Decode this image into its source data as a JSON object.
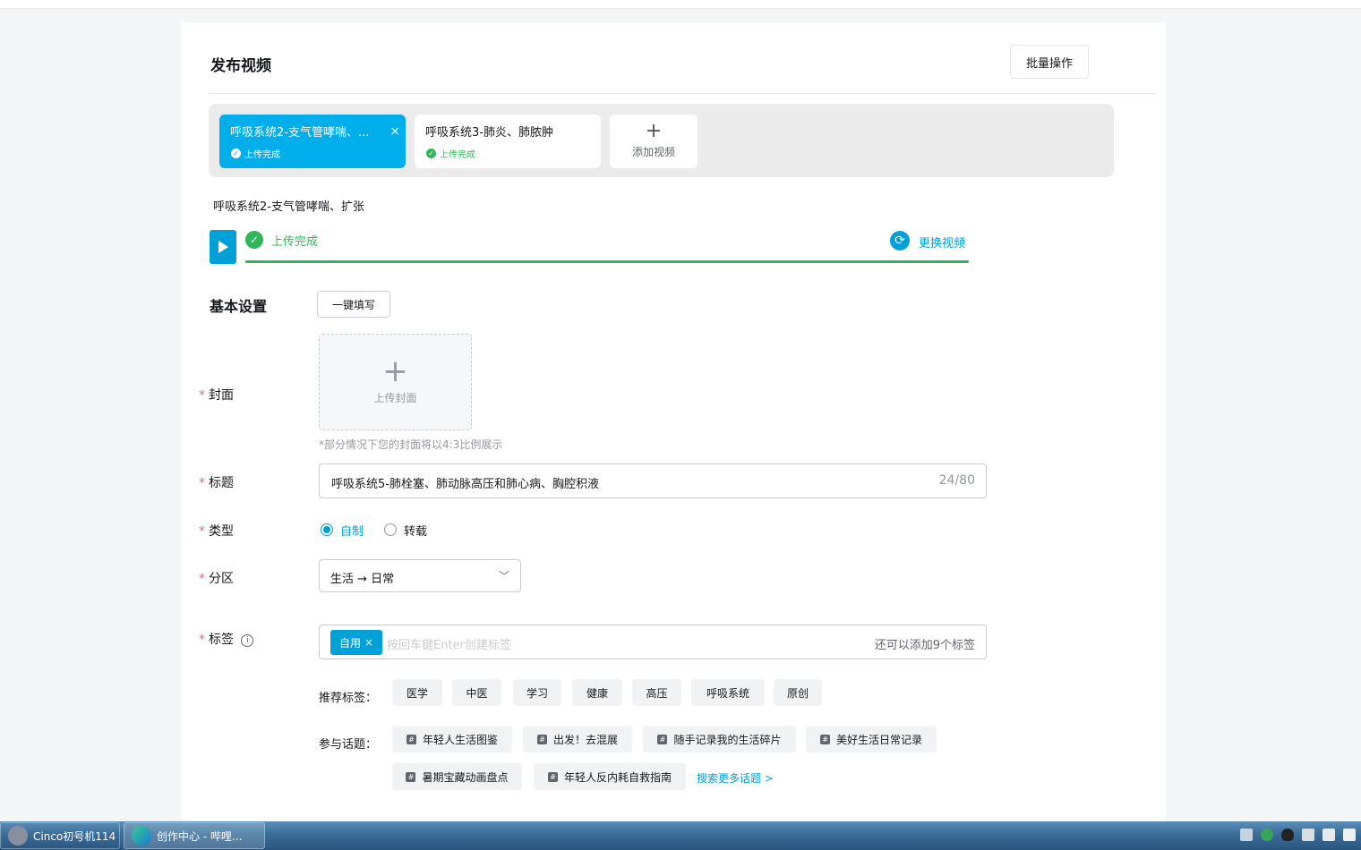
{
  "header": {
    "title": "发布视频",
    "batch_label": "批量操作"
  },
  "videos": [
    {
      "name": "呼吸系统2-支气管哮喘、...",
      "status": "上传完成",
      "close": "×"
    },
    {
      "name": "呼吸系统3-肺炎、肺脓肿",
      "status": "上传完成"
    }
  ],
  "add_video": {
    "plus": "+",
    "label": "添加视频"
  },
  "current_file": {
    "name": "呼吸系统2-支气管哮喘、扩张",
    "status": "上传完成",
    "progress": 1.0,
    "replace_label": "更换视频"
  },
  "section": {
    "title": "基本设置",
    "autofill_label": "一键填写"
  },
  "form": {
    "required_mark": "*",
    "cover": {
      "label": "封面",
      "upload_plus": "+",
      "upload_label": "上传封面",
      "hint": "*部分情况下您的封面将以4:3比例展示"
    },
    "title": {
      "label": "标题",
      "value": "呼吸系统5-肺栓塞、肺动脉高压和肺心病、胸腔积液",
      "count": "24/80"
    },
    "type": {
      "label": "类型",
      "options": [
        "自制",
        "转载"
      ],
      "selected": "自制"
    },
    "zone": {
      "label": "分区",
      "value": "生活 → 日常",
      "chevron": "﹀"
    },
    "tags": {
      "label": "标签",
      "info": "i",
      "chip": "自用",
      "chip_close": "×",
      "placeholder": "按回车键Enter创建标签",
      "remaining": "还可以添加9个标签"
    },
    "recommended": {
      "label": "推荐标签：",
      "items": [
        "医学",
        "中医",
        "学习",
        "健康",
        "高压",
        "呼吸系统",
        "原创"
      ]
    },
    "topics": {
      "label": "参与话题：",
      "items": [
        "年轻人生活图鉴",
        "出发！去混展",
        "随手记录我的生活碎片",
        "美好生活日常记录",
        "暑期宝藏动画盘点",
        "年轻人反内耗自救指南"
      ],
      "more": "搜索更多话题 >"
    }
  },
  "taskbar": {
    "items": [
      "Cinco初号机114",
      "创作中心 - 哔哩..."
    ]
  },
  "colors": {
    "accent": "#00a1d6",
    "active_card": "#00aeec",
    "success": "#2fb65a",
    "required": "#f25d8e"
  }
}
